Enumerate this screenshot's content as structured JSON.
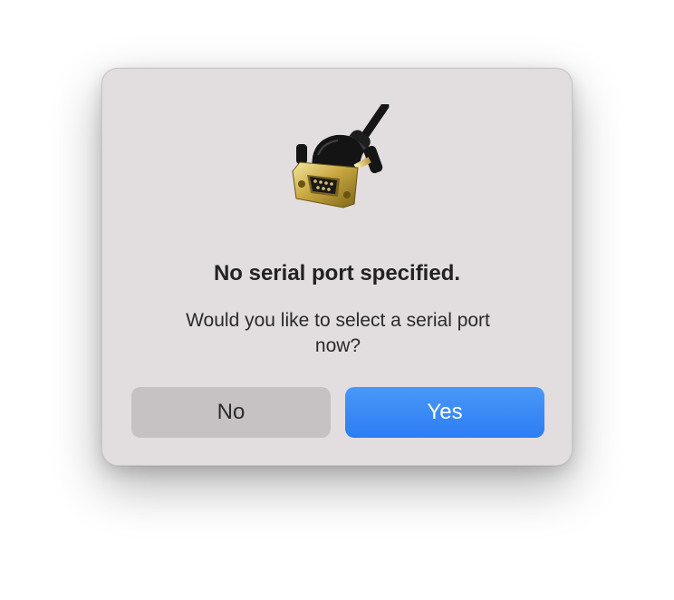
{
  "dialog": {
    "icon": "serial-port-connector-icon",
    "title": "No serial port specified.",
    "message": "Would you like to select a serial port now?",
    "buttons": {
      "no_label": "No",
      "yes_label": "Yes"
    }
  },
  "colors": {
    "dialog_background": "#e2dedf",
    "secondary_button": "#c6c2c3",
    "primary_button": "#2f80f4",
    "title_text": "#222222"
  }
}
